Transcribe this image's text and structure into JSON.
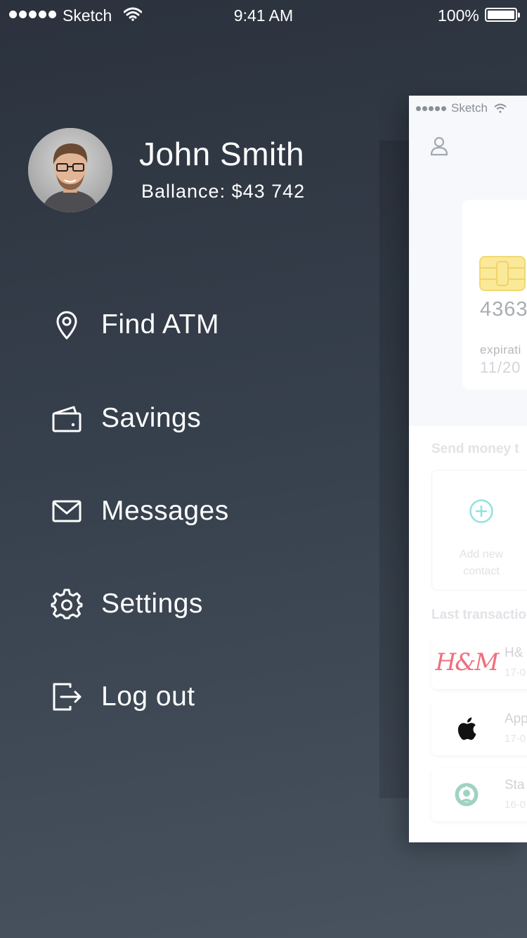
{
  "status_bar": {
    "carrier": "Sketch",
    "time": "9:41 AM",
    "battery": "100%",
    "signal_icon": "signal-dots-icon",
    "wifi_icon": "wifi-icon",
    "battery_icon": "battery-icon"
  },
  "profile": {
    "name": "John Smith",
    "balance": "Ballance: $43 742"
  },
  "menu": {
    "items": [
      {
        "label": "Find ATM",
        "icon": "location-pin-icon"
      },
      {
        "label": "Savings",
        "icon": "wallet-icon"
      },
      {
        "label": "Messages",
        "icon": "envelope-icon"
      },
      {
        "label": "Settings",
        "icon": "gear-icon"
      },
      {
        "label": "Log out",
        "icon": "logout-icon"
      }
    ]
  },
  "preview": {
    "status_carrier": "Sketch",
    "card_number": "4363",
    "expiration_label": "expirati",
    "expiration_value": "11/20",
    "send_money_title": "Send money t",
    "add_contact_label": "Add new contact",
    "add_contact_line1": "Add new",
    "add_contact_line2": "contact",
    "last_transactions_title": "Last transactio",
    "transactions": [
      {
        "name": "H&",
        "date": "17-0",
        "logo": "hm-logo"
      },
      {
        "name": "App",
        "date": "17-0",
        "logo": "apple-icon"
      },
      {
        "name": "Sta",
        "date": "16-0",
        "logo": "starbucks-icon"
      }
    ],
    "hm_logo_text": "H&M"
  },
  "colors": {
    "background_top": "#2b323d",
    "background_bottom": "#48535f",
    "text": "#ffffff",
    "accent_teal": "#8fe3de",
    "chip_yellow": "#fbe99a",
    "hm_red": "#ef6f7d"
  }
}
